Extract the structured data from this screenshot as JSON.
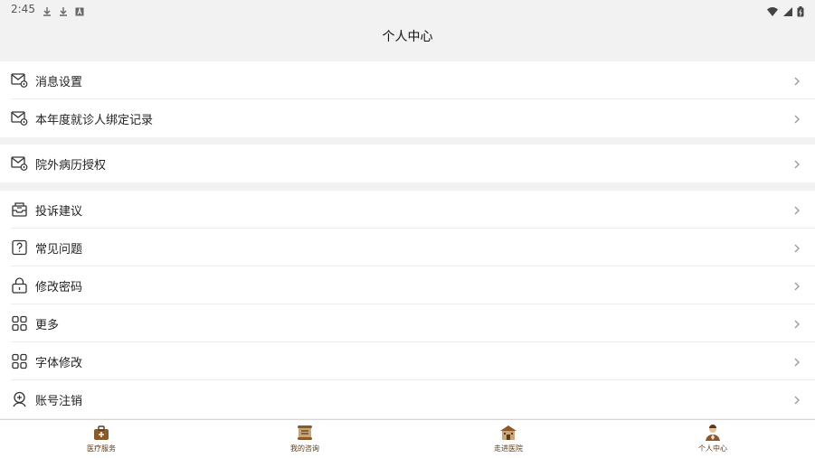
{
  "status_bar": {
    "time": "2:45",
    "left_icons": [
      "download-icon",
      "download-icon",
      "a-icon"
    ],
    "right_icons": [
      "wifi-icon",
      "signal-icon",
      "battery-icon"
    ]
  },
  "header": {
    "title": "个人中心"
  },
  "groups": [
    {
      "items": [
        {
          "label": "消息设置",
          "icon": "mail-settings-icon"
        },
        {
          "label": "本年度就诊人绑定记录",
          "icon": "mail-settings-icon"
        }
      ]
    },
    {
      "items": [
        {
          "label": "院外病历授权",
          "icon": "mail-settings-icon"
        }
      ]
    },
    {
      "items": [
        {
          "label": "投诉建议",
          "icon": "inbox-icon"
        },
        {
          "label": "常见问题",
          "icon": "question-icon"
        },
        {
          "label": "修改密码",
          "icon": "lock-icon"
        },
        {
          "label": "更多",
          "icon": "grid-icon"
        },
        {
          "label": "字体修改",
          "icon": "grid-icon"
        },
        {
          "label": "账号注销",
          "icon": "user-badge-icon"
        }
      ]
    }
  ],
  "tabs": [
    {
      "label": "医疗服务",
      "icon": "medical-kit-icon"
    },
    {
      "label": "我的咨询",
      "icon": "scroll-icon"
    },
    {
      "label": "走进医院",
      "icon": "hospital-icon"
    },
    {
      "label": "个人中心",
      "icon": "person-icon"
    }
  ],
  "colors": {
    "accent": "#8b5a2b",
    "background": "#f2f2f2",
    "row": "#ffffff",
    "divider": "#ececec"
  }
}
